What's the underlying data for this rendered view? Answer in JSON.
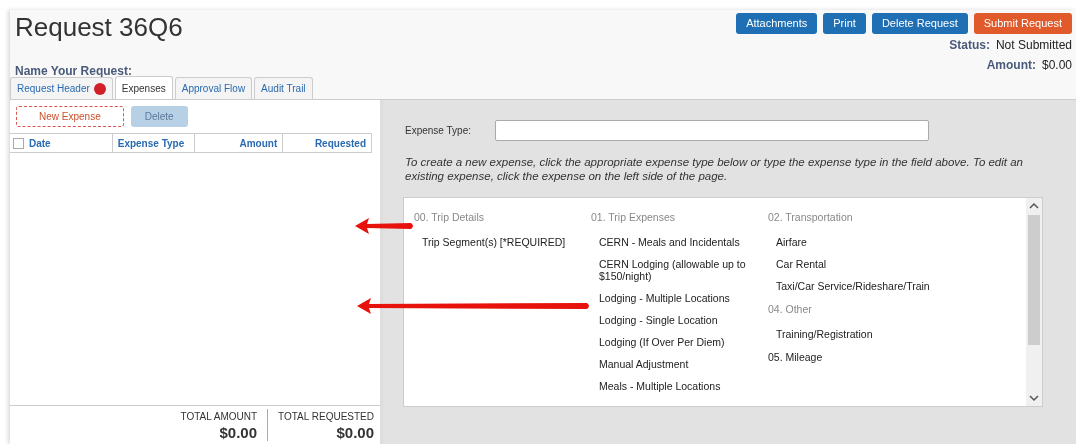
{
  "title": "Request 36Q6",
  "name_label": "Name Your Request:",
  "actions": [
    {
      "label": "Attachments",
      "kind": "primary"
    },
    {
      "label": "Print",
      "kind": "primary"
    },
    {
      "label": "Delete Request",
      "kind": "primary"
    },
    {
      "label": "Submit Request",
      "kind": "submit"
    }
  ],
  "status": {
    "label": "Status:",
    "value": "Not Submitted"
  },
  "amount": {
    "label": "Amount:",
    "value": "$0.00"
  },
  "tabs": [
    {
      "label": "Request Header",
      "selected": false,
      "alert": true
    },
    {
      "label": "Expenses",
      "selected": true,
      "alert": false
    },
    {
      "label": "Approval Flow",
      "selected": false,
      "alert": false
    },
    {
      "label": "Audit Trail",
      "selected": false,
      "alert": false
    }
  ],
  "toolbar": [
    {
      "label": "New Expense",
      "disabled": false
    },
    {
      "label": "Delete",
      "disabled": true
    }
  ],
  "table": {
    "checked": false,
    "columns": [
      "Date",
      "Expense Type",
      "Amount",
      "Requested"
    ]
  },
  "totals": [
    {
      "label": "TOTAL AMOUNT",
      "value": "$0.00"
    },
    {
      "label": "TOTAL REQUESTED",
      "value": "$0.00"
    }
  ],
  "expense_type": {
    "label": "Expense Type:"
  },
  "instructions": "To create a new expense, click the appropriate expense type below or type the expense type in the field above. To edit an existing expense, click the expense on the left side of the page.",
  "columns": [
    [
      {
        "kind": "heading",
        "text": "00. Trip Details"
      },
      {
        "kind": "item",
        "text": "Trip Segment(s) [*REQUIRED]"
      }
    ],
    [
      {
        "kind": "heading",
        "text": "01. Trip Expenses"
      },
      {
        "kind": "item",
        "text": "CERN - Meals and Incidentals"
      },
      {
        "kind": "item",
        "text": "CERN Lodging (allowable up to $150/night)"
      },
      {
        "kind": "item",
        "text": "Lodging - Multiple Locations"
      },
      {
        "kind": "item",
        "text": "Lodging - Single Location"
      },
      {
        "kind": "item",
        "text": "Lodging (If Over Per Diem)"
      },
      {
        "kind": "item",
        "text": "Manual Adjustment"
      },
      {
        "kind": "item",
        "text": "Meals - Multiple Locations"
      }
    ],
    [
      {
        "kind": "heading",
        "text": "02. Transportation"
      },
      {
        "kind": "item",
        "text": "Airfare"
      },
      {
        "kind": "item",
        "text": "Car Rental"
      },
      {
        "kind": "item",
        "text": "Taxi/Car Service/Rideshare/Train"
      },
      {
        "kind": "heading",
        "text": "04. Other"
      },
      {
        "kind": "item",
        "text": "Training/Registration"
      },
      {
        "kind": "link-heading",
        "text": "05. Mileage"
      }
    ]
  ]
}
